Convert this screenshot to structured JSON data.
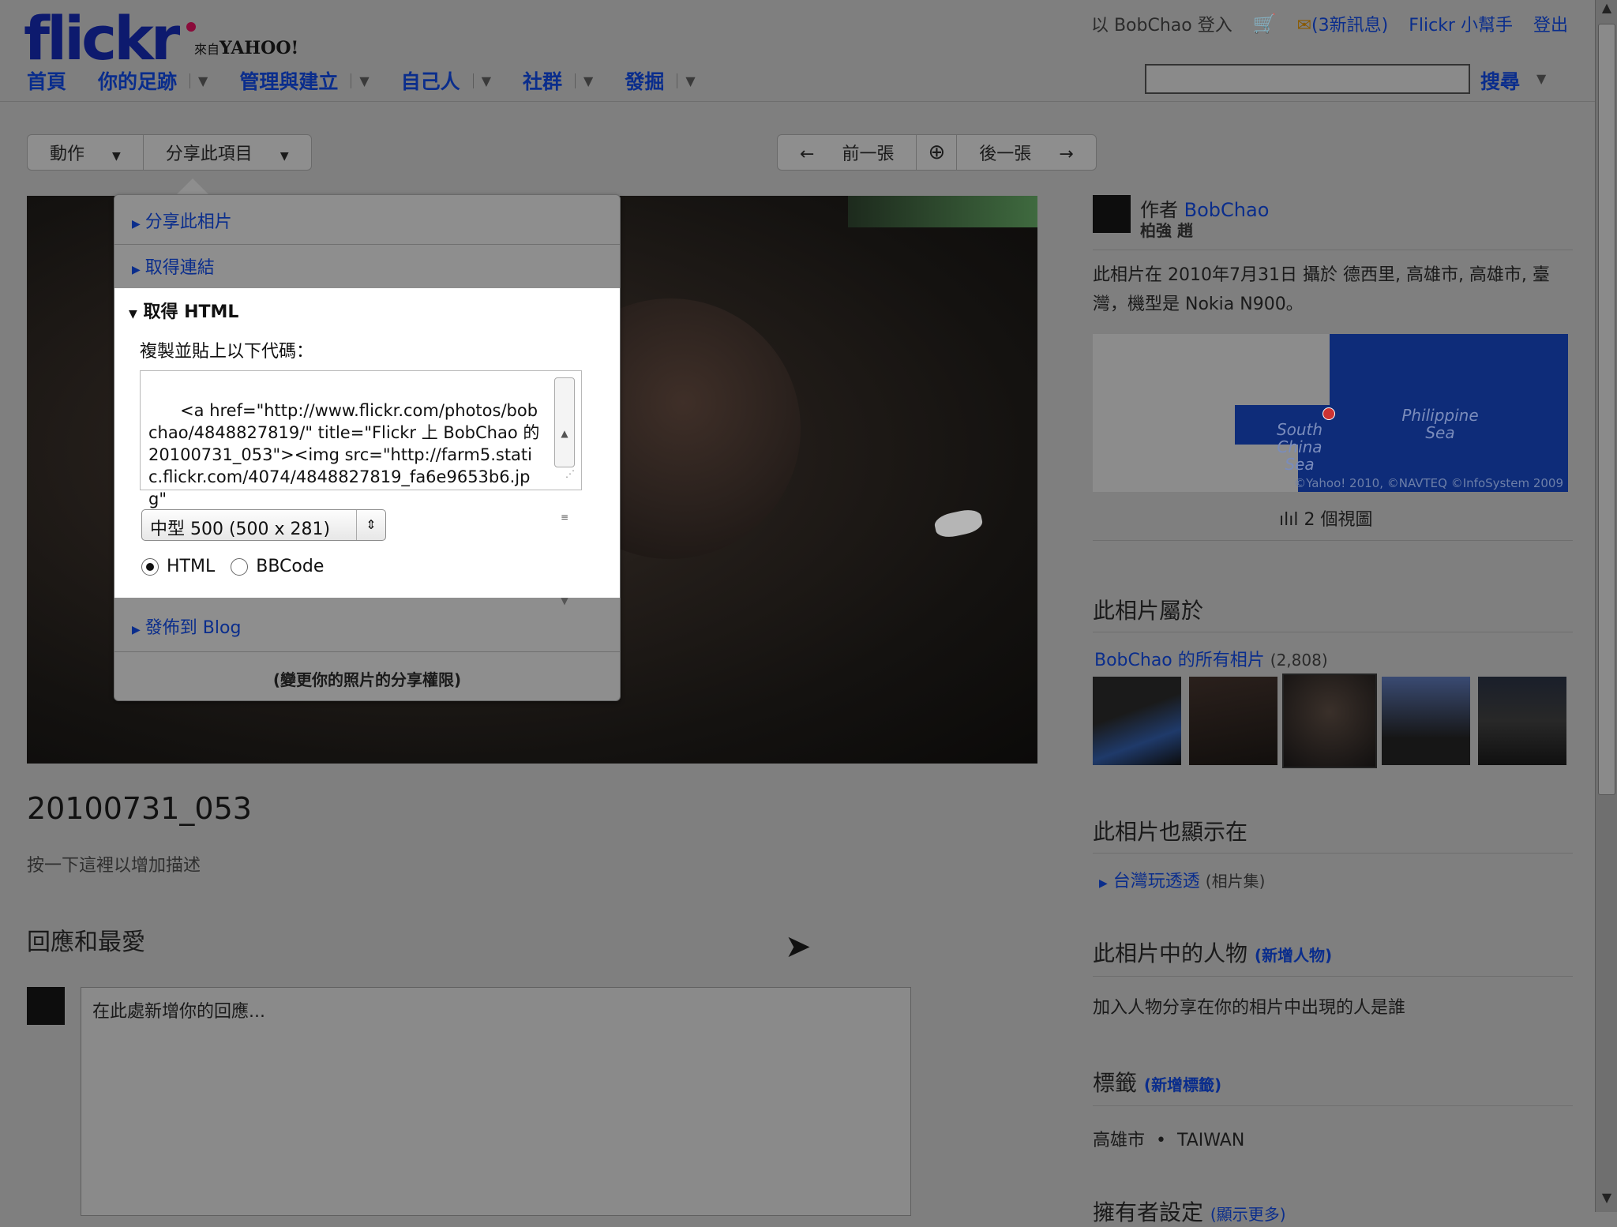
{
  "header": {
    "logo_text": "flickr",
    "yahoo_prefix": "來自",
    "yahoo_text": "YAHOO!",
    "signed_in": "以 BobChao 登入",
    "messages": "(3新訊息)",
    "helper": "Flickr 小幫手",
    "logout": "登出",
    "nav": [
      "首頁",
      "你的足跡",
      "管理與建立",
      "自己人",
      "社群",
      "發掘"
    ],
    "search_label": "搜尋"
  },
  "toolbar": {
    "actions": "動作",
    "share": "分享此項目",
    "prev": "前一張",
    "next": "後一張"
  },
  "share_panel": {
    "share_photo": "分享此相片",
    "get_link": "取得連結",
    "get_html": "取得 HTML",
    "copy_label": "複製並貼上以下代碼：",
    "code": "<a href=\"http://www.flickr.com/photos/bobchao/4848827819/\" title=\"Flickr 上 BobChao 的 20100731_053\"><img src=\"http://farm5.static.flickr.com/4074/4848827819_fa6e9653b6.jpg\"",
    "size_select": "中型 500 (500 x 281)",
    "radio_html": "HTML",
    "radio_bbcode": "BBCode",
    "post_blog": "發佈到 Blog",
    "permissions": "(變更你的照片的分享權限)"
  },
  "photo": {
    "title": "20100731_053",
    "description_prompt": "按一下這裡以增加描述"
  },
  "comments": {
    "heading": "回應和最愛",
    "placeholder": "在此處新增你的回應..."
  },
  "sidebar": {
    "author_prefix": "作者",
    "author_name": "BobChao",
    "author_realname": "柏強 趙",
    "taken_info": "此相片在 2010年7月31日 攝於 德西里, 高雄市, 高雄市, 臺灣，機型是 Nokia N900。",
    "map_label_1": "South China Sea",
    "map_label_2": "Philippine Sea",
    "map_copyright": "©Yahoo! 2010, ©NAVTEQ ©InfoSystem 2009",
    "views": "2 個視圖",
    "belongs_heading": "此相片屬於",
    "all_photos": "BobChao 的所有相片",
    "all_photos_count": "(2,808)",
    "also_heading": "此相片也顯示在",
    "set_name": "台灣玩透透",
    "set_suffix": "(相片集)",
    "people_heading": "此相片中的人物",
    "add_people": "(新增人物)",
    "people_text": "加入人物分享在你的相片中出現的人是誰",
    "tags_heading": "標籤",
    "add_tags": "(新增標籤)",
    "tags": [
      "高雄市",
      "TAIWAN"
    ],
    "owner_heading": "擁有者設定",
    "owner_link": "(顯示更多)"
  }
}
